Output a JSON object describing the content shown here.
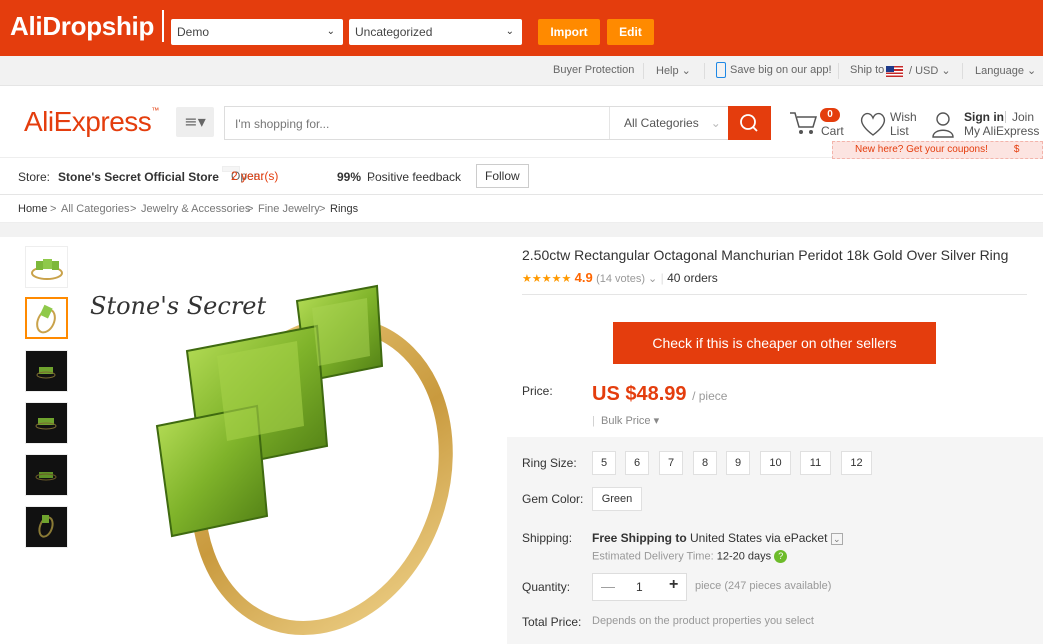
{
  "extension": {
    "logo": "AliDropship",
    "store_select": "Demo",
    "category_select": "Uncategorized",
    "import_label": "Import",
    "edit_label": "Edit"
  },
  "toplinks": {
    "buyer_protection": "Buyer Protection",
    "help": "Help",
    "app": "Save big on our app!",
    "ship_to": "Ship to",
    "currency": "/  USD",
    "language": "Language"
  },
  "header": {
    "logo": "AliExpress",
    "search_placeholder": "I'm shopping for...",
    "search_category": "All Categories",
    "cart_count": "0",
    "cart_label": "Cart",
    "wish_label1": "Wish",
    "wish_label2": "List",
    "sign_in": "Sign in",
    "join": "Join",
    "my_ali": "My AliExpress",
    "coupon": "New here? Get your coupons!",
    "coupon_suffix": "$"
  },
  "store": {
    "label": "Store:",
    "name": "Stone's Secret Official Store",
    "open_label": "Open:",
    "open_value": "2 year(s)",
    "feedback_pct": "99%",
    "feedback_label": "Positive feedback",
    "follow": "Follow"
  },
  "breadcrumb": [
    "Home",
    "All Categories",
    "Jewelry & Accessories",
    "Fine Jewelry",
    "Rings"
  ],
  "product": {
    "brand_watermark": "Stone's Secret",
    "title": "2.50ctw Rectangular Octagonal Manchurian Peridot 18k Gold Over Silver Ring",
    "stars": "★★★★★",
    "rating": "4.9",
    "votes": "(14 votes)",
    "orders": "40 orders",
    "check_btn": "Check if this is cheaper on other sellers",
    "price_label": "Price:",
    "price": "US $48.99",
    "price_unit": "/ piece",
    "bulk": "Bulk Price",
    "ring_size_label": "Ring Size:",
    "ring_sizes": [
      "5",
      "6",
      "7",
      "8",
      "9",
      "10",
      "11",
      "12"
    ],
    "gem_label": "Gem Color:",
    "gem_value": "Green",
    "shipping_label": "Shipping:",
    "shipping_free": "Free Shipping to",
    "shipping_dest": "United States via ePacket",
    "delivery_label": "Estimated Delivery Time:",
    "delivery_value": "12-20 days",
    "quantity_label": "Quantity:",
    "quantity_value": "1",
    "quantity_avail": "piece (247 pieces available)",
    "total_label": "Total Price:",
    "total_value": "Depends on the product properties you select"
  },
  "colors": {
    "brand": "#e43d0d",
    "accent": "#ff8a00"
  }
}
